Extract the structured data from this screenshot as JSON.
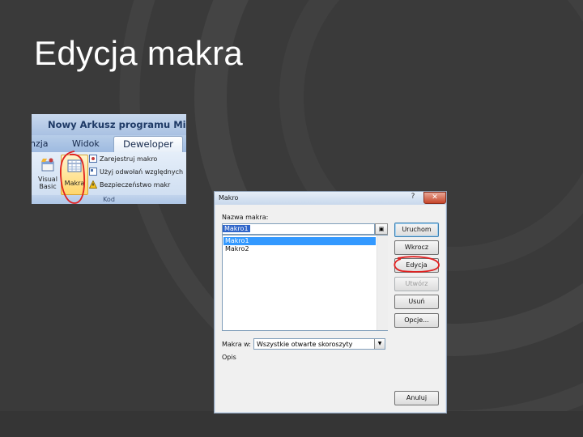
{
  "slide": {
    "title": "Edycja makra"
  },
  "ribbon": {
    "window_title": "Nowy Arkusz programu Microso",
    "tabs": [
      {
        "label": "nzja"
      },
      {
        "label": "Widok"
      },
      {
        "label": "Deweloper"
      }
    ],
    "buttons": {
      "visual_basic": "Visual Basic",
      "makra": "Makra"
    },
    "small_items": [
      "Zarejestruj makro",
      "Użyj odwołań względnych",
      "Bezpieczeństwo makr"
    ],
    "group_label": "Kod",
    "accent": "#e02020"
  },
  "dialog": {
    "title": "Makro",
    "help_icon": "question-icon",
    "close_label": "✕",
    "name_label": "Nazwa makra:",
    "name_value": "Makro1",
    "macros": [
      "Makro1",
      "Makro2"
    ],
    "selected_macro": "Makro1",
    "buttons": {
      "run": "Uruchom",
      "step": "Wkrocz",
      "edit": "Edycja",
      "create": "Utwórz",
      "delete": "Usuń",
      "options": "Opcje...",
      "cancel": "Anuluj"
    },
    "macros_in_label": "Makra w:",
    "macros_in_value": "Wszystkie otwarte skoroszyty",
    "description_label": "Opis"
  }
}
